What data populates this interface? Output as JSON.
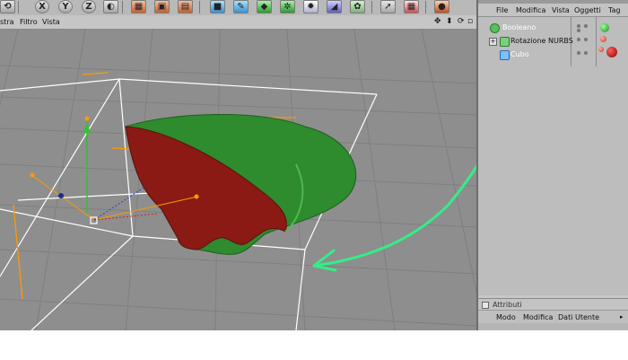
{
  "toolbar": {
    "axis_labels": [
      "X",
      "Y",
      "Z"
    ]
  },
  "viewport_menu": {
    "items": [
      "stra",
      "Filtro",
      "Vista"
    ]
  },
  "object_manager": {
    "menu": [
      "File",
      "Modifica",
      "Vista",
      "Oggetti",
      "Tag"
    ],
    "objects": [
      {
        "label": "Booleano",
        "type": "boolean"
      },
      {
        "label": "Rotazione NURBS",
        "type": "nurbs"
      },
      {
        "label": "Cubo",
        "type": "cube"
      }
    ]
  },
  "attributes": {
    "title": "Attributi",
    "menu": [
      "Modo",
      "Modifica",
      "Dati Utente"
    ]
  },
  "colors": {
    "annotation_arrow": "#33ee88",
    "shape_green": "#2e8b2e",
    "shape_red": "#8b1a14",
    "selection_box": "#ffffff",
    "axis_orange": "#ff9900"
  }
}
